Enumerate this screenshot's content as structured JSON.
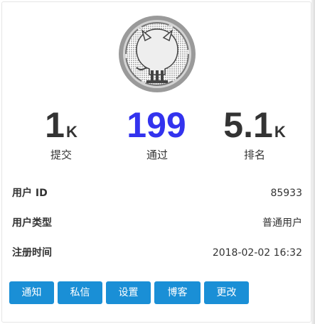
{
  "stats": [
    {
      "value": "1",
      "unit": "K",
      "label": "提交"
    },
    {
      "value": "199",
      "unit": "",
      "label": "通过"
    },
    {
      "value": "5.1",
      "unit": "K",
      "label": "排名"
    }
  ],
  "info": {
    "user_id_label": "用户 ID",
    "user_id_value": "85933",
    "user_type_label": "用户类型",
    "user_type_value": "普通用户",
    "register_time_label": "注册时间",
    "register_time_value": "2018-02-02 16:32"
  },
  "buttons": {
    "notify": "通知",
    "message": "私信",
    "settings": "设置",
    "blog": "博客",
    "edit": "更改"
  },
  "colors": {
    "accent_number": "#3333ee",
    "button": "#1a8fd6"
  },
  "icons": {
    "avatar": "github-octocat-avatar"
  }
}
